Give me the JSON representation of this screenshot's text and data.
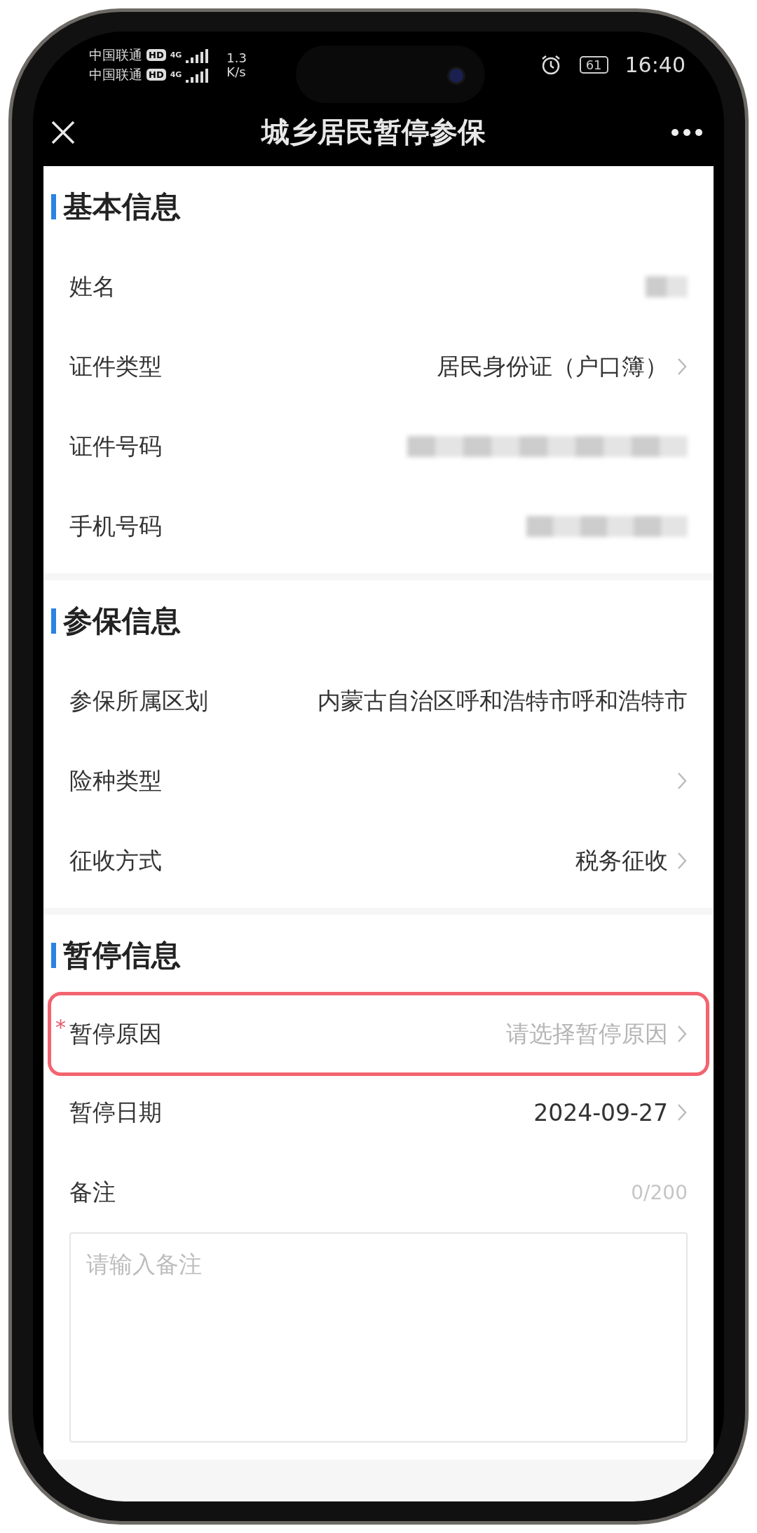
{
  "status_bar": {
    "carriers": [
      {
        "name": "中国联通",
        "badge": "HD",
        "network": "4G"
      },
      {
        "name": "中国联通",
        "badge": "HD",
        "network": "4G"
      }
    ],
    "speed": [
      "1.3",
      "K/s"
    ],
    "battery": "61",
    "time": "16:40"
  },
  "nav": {
    "title": "城乡居民暂停参保"
  },
  "sections": [
    {
      "title": "基本信息",
      "rows": [
        {
          "label": "姓名",
          "kind": "redacted",
          "chevron": false
        },
        {
          "label": "证件类型",
          "kind": "text",
          "value": "居民身份证（户口簿）",
          "chevron": true
        },
        {
          "label": "证件号码",
          "kind": "redacted",
          "chevron": false
        },
        {
          "label": "手机号码",
          "kind": "redacted",
          "chevron": false
        }
      ]
    },
    {
      "title": "参保信息",
      "rows": [
        {
          "label": "参保所属区划",
          "kind": "text",
          "value": "内蒙古自治区呼和浩特市呼和浩特市",
          "chevron": false
        },
        {
          "label": "险种类型",
          "kind": "text",
          "chevron": true
        },
        {
          "label": "征收方式",
          "kind": "text",
          "value": "税务征收",
          "chevron": true
        }
      ]
    },
    {
      "title": "暂停信息",
      "rows": [
        {
          "label": "暂停原因",
          "kind": "select",
          "placeholder": "请选择暂停原因",
          "chevron": true,
          "required_mark": "*",
          "highlighted": true
        },
        {
          "label": "暂停日期",
          "kind": "text",
          "value": "2024-09-27",
          "chevron": true
        },
        {
          "label": "备注",
          "kind": "textarea",
          "counter": "0/200",
          "placeholder": "请输入备注"
        }
      ]
    }
  ]
}
